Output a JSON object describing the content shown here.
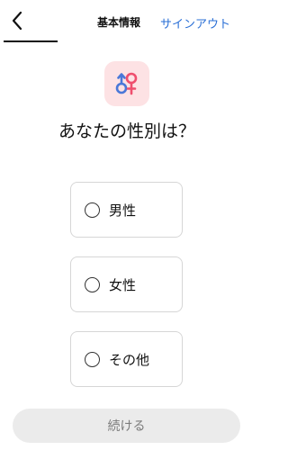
{
  "header": {
    "back_icon": "chevron-left-icon",
    "title": "基本情報",
    "signout_label": "サインアウト",
    "link_color": "#2a6fd6"
  },
  "badge": {
    "icon": "gender-icon",
    "background": "#fde2e4",
    "male_color": "#4a78d8",
    "female_color": "#ef4f6e"
  },
  "question": "あなたの性別は？",
  "options": [
    {
      "label": "男性",
      "selected": false
    },
    {
      "label": "女性",
      "selected": false
    },
    {
      "label": "その他",
      "selected": false
    }
  ],
  "continue_label": "続ける",
  "continue_enabled": false
}
